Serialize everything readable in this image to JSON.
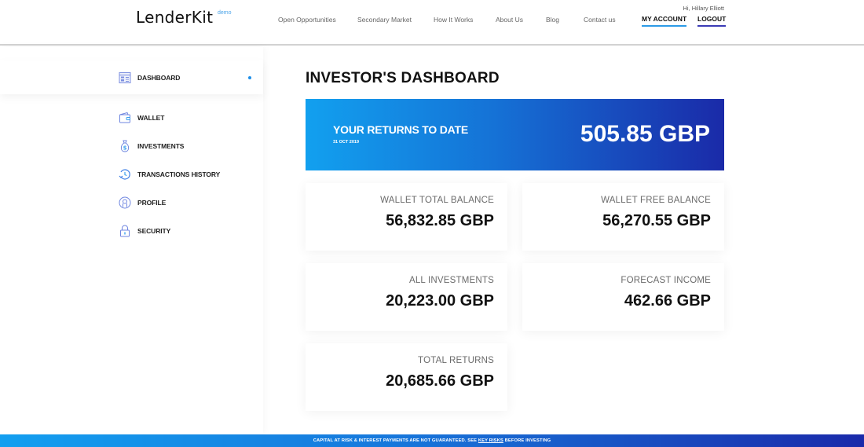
{
  "header": {
    "logo": "LenderKit",
    "logo_tag": "demo",
    "nav": [
      "Open Opportunities",
      "Secondary Market",
      "How It Works",
      "About Us",
      "Blog",
      "Contact us"
    ],
    "greeting": "Hi, Hillary Elliott",
    "my_account": "MY ACCOUNT",
    "logout": "LOGOUT"
  },
  "sidebar": {
    "items": [
      {
        "label": "DASHBOARD",
        "icon": "dashboard-icon",
        "active": true
      },
      {
        "label": "WALLET",
        "icon": "wallet-icon"
      },
      {
        "label": "INVESTMENTS",
        "icon": "money-bag-icon"
      },
      {
        "label": "TRANSACTIONS HISTORY",
        "icon": "history-icon"
      },
      {
        "label": "PROFILE",
        "icon": "profile-icon"
      },
      {
        "label": "SECURITY",
        "icon": "lock-icon"
      }
    ]
  },
  "main": {
    "title": "INVESTOR'S DASHBOARD",
    "returns": {
      "title": "YOUR RETURNS TO DATE",
      "date": "31 OCT 2019",
      "value": "505.85 GBP"
    },
    "cards": [
      {
        "label": "WALLET TOTAL BALANCE",
        "value": "56,832.85 GBP"
      },
      {
        "label": "WALLET FREE BALANCE",
        "value": "56,270.55 GBP"
      },
      {
        "label": "ALL INVESTMENTS",
        "value": "20,223.00 GBP"
      },
      {
        "label": "FORECAST INCOME",
        "value": "462.66 GBP"
      },
      {
        "label": "TOTAL RETURNS",
        "value": "20,685.66 GBP"
      }
    ]
  },
  "footer": {
    "text_before": "CAPITAL AT RISK & INTEREST PAYMENTS ARE NOT GUARANTEED. SEE ",
    "link": "KEY RISKS",
    "text_after": " BEFORE INVESTING"
  },
  "colors": {
    "accent_light": "#12a0ef",
    "accent_dark": "#1a2aa8",
    "active_dot": "#1e8fe8"
  }
}
